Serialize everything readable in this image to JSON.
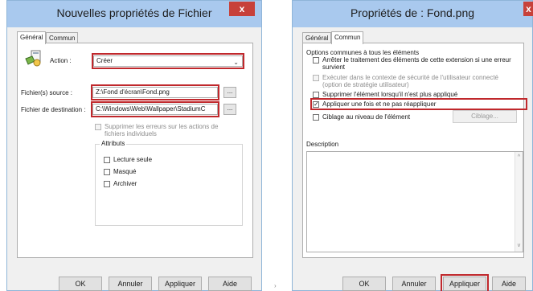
{
  "left_dialog": {
    "title": "Nouvelles propriétés de Fichier",
    "close_label": "x",
    "tabs": [
      "Général",
      "Commun"
    ],
    "action_label": "Action :",
    "action_value": "Créer",
    "source_label": "Fichier(s) source :",
    "source_value": "Z:\\Fond d'écran\\Fond.png",
    "dest_label": "Fichier de destination :",
    "dest_value": "C:\\Windows\\Web\\Wallpaper\\StadiumC",
    "browse_label": "...",
    "suppress_label": "Supprimer les erreurs sur les actions de fichiers individuels",
    "attributes_title": "Attributs",
    "attributes": [
      "Lecture seule",
      "Masqué",
      "Archiver"
    ],
    "buttons": {
      "ok": "OK",
      "cancel": "Annuler",
      "apply": "Appliquer",
      "help": "Aide"
    }
  },
  "right_dialog": {
    "title": "Propriétés de : Fond.png",
    "close_label": "x",
    "tabs": [
      "Général",
      "Commun"
    ],
    "options_title": "Options communes à tous les éléments",
    "options": [
      {
        "label": "Arrêter le traitement des éléments de cette extension si une erreur survient",
        "checked": false,
        "disabled": false
      },
      {
        "label": "Exécuter dans le contexte de sécurité de l'utilisateur connecté (option de stratégie utilisateur)",
        "checked": false,
        "disabled": true
      },
      {
        "label": "Supprimer l'élément lorsqu'il n'est plus appliqué",
        "checked": false,
        "disabled": false
      },
      {
        "label": "Appliquer une fois et ne pas réappliquer",
        "checked": true,
        "disabled": false
      },
      {
        "label": "Ciblage au niveau de l'élément",
        "checked": false,
        "disabled": false
      }
    ],
    "targeting_button": "Ciblage...",
    "description_label": "Description",
    "buttons": {
      "ok": "OK",
      "cancel": "Annuler",
      "apply": "Appliquer",
      "help": "Aide"
    }
  },
  "separator_glyph": "›",
  "colors": {
    "titlebar": "#a9c9ee",
    "highlight": "#c0282c",
    "close": "#c7413a",
    "dialog_bg": "#f0f0f0"
  }
}
